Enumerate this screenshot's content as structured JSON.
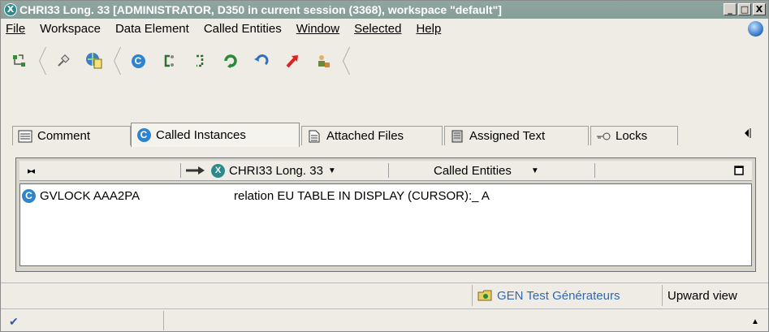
{
  "window": {
    "title": "CHRI33 Long. 33 [ADMINISTRATOR, D350 in current session (3368), workspace \"default\"]",
    "close_icon_label": "X",
    "controls": {
      "minimize": "_",
      "maximize": "□",
      "close": "X"
    }
  },
  "menu": {
    "items": [
      "File",
      "Workspace",
      "Data Element",
      "Called Entities",
      "Window",
      "Selected",
      "Help"
    ]
  },
  "toolbar": {
    "icons": [
      "tree-expand-icon",
      "pin-icon",
      "globe-document-icon",
      "called-entity-icon",
      "bracket-icon",
      "dashed-bracket-icon",
      "refresh-icon",
      "undo-icon",
      "arrow-up-right-icon",
      "people-icon"
    ],
    "called_entity_letter": "C"
  },
  "tabs": [
    {
      "label": "Comment"
    },
    {
      "label": "Called Instances",
      "icon_letter": "C"
    },
    {
      "label": "Attached Files"
    },
    {
      "label": "Assigned Text"
    },
    {
      "label": "Locks"
    }
  ],
  "header": {
    "collapse_glyph": "▸◂",
    "entity_label": "CHRI33 Long. 33",
    "column_label": "Called Entities",
    "entity_icon_letter": "X"
  },
  "rows": [
    {
      "icon_letter": "C",
      "name": "GVLOCK AAA2PA",
      "relation": "relation EU   TABLE IN DISPLAY (CURSOR):_ A"
    }
  ],
  "status": {
    "gen_label": "GEN Test Générateurs",
    "view_label": "Upward view",
    "check_glyph": "✔",
    "up_glyph": "▲"
  },
  "colors": {
    "titlebar": "#879e98",
    "accent_blue": "#2f84ce",
    "gen_text": "#3467b0"
  }
}
